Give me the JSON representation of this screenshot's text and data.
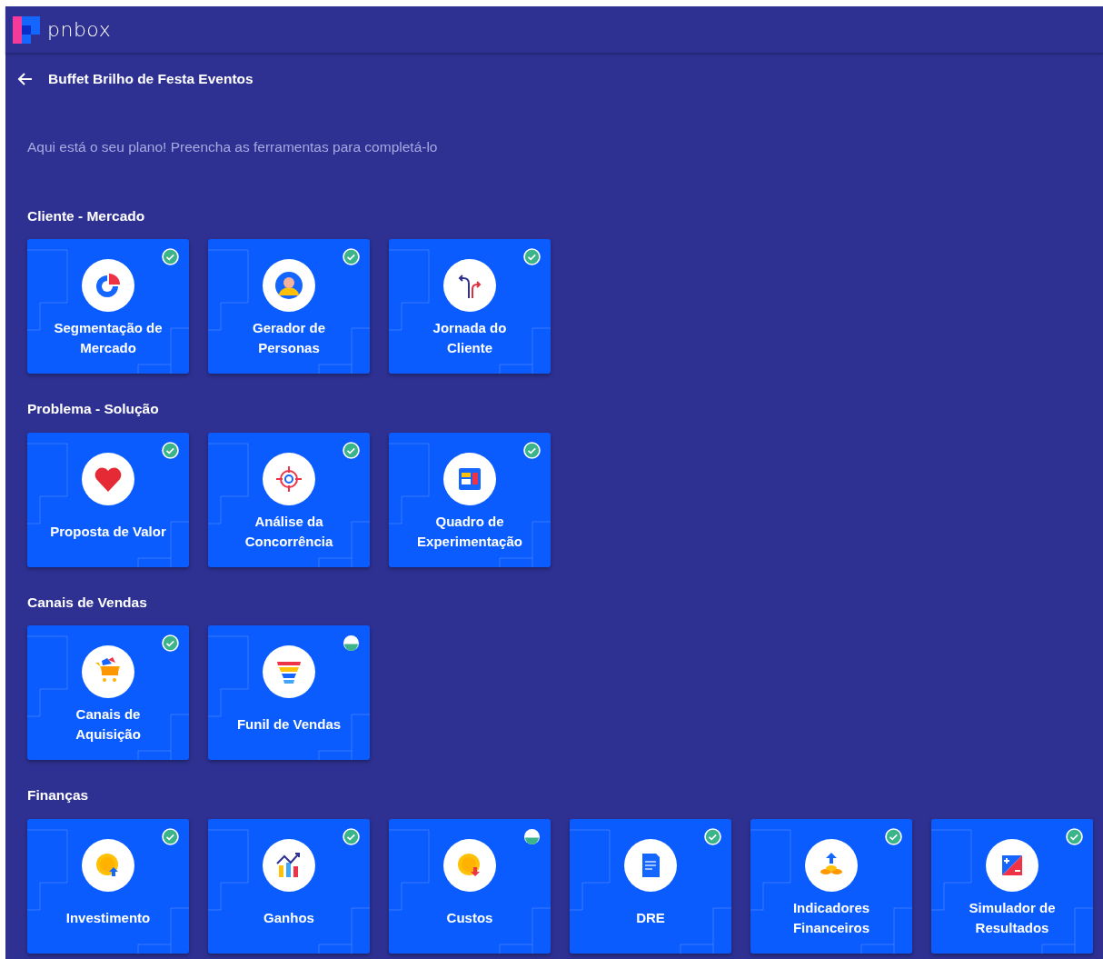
{
  "brand": "pnbox",
  "title": "Buffet Brilho de Festa Eventos",
  "intro": "Aqui está o seu plano! Preencha as ferramentas para completá-lo",
  "sections": [
    {
      "heading": "Cliente - Mercado",
      "tools": [
        {
          "label": "Segmentação de\nMercado",
          "complete": true
        },
        {
          "label": "Gerador de\nPersonas",
          "complete": true
        },
        {
          "label": "Jornada do\nCliente",
          "complete": true
        }
      ]
    },
    {
      "heading": "Problema - Solução",
      "tools": [
        {
          "label": "Proposta de Valor",
          "complete": true
        },
        {
          "label": "Análise da\nConcorrência",
          "complete": true
        },
        {
          "label": "Quadro de\nExperimentação",
          "complete": true
        }
      ]
    },
    {
      "heading": "Canais de Vendas",
      "tools": [
        {
          "label": "Canais de\nAquisição",
          "complete": true
        },
        {
          "label": "Funil de Vendas",
          "complete": false
        }
      ]
    },
    {
      "heading": "Finanças",
      "tools": [
        {
          "label": "Investimento",
          "complete": true
        },
        {
          "label": "Ganhos",
          "complete": true
        },
        {
          "label": "Custos",
          "complete": false
        },
        {
          "label": "DRE",
          "complete": true
        },
        {
          "label": "Indicadores\nFinanceiros",
          "complete": true
        },
        {
          "label": "Simulador de\nResultados",
          "complete": true
        }
      ]
    }
  ]
}
